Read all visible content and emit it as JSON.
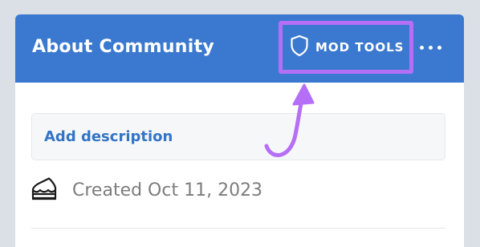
{
  "widget": {
    "title": "About Community",
    "mod_tools_label": "MOD TOOLS",
    "description_link": "Add description",
    "created": "Created Oct 11, 2023"
  },
  "icons": {
    "mod_tools": "shield-icon",
    "more": "more-horizontal-icon",
    "created": "cake-icon"
  },
  "colors": {
    "header": "#3a79cf",
    "link": "#3274c6",
    "highlight": "#b56ff7",
    "background": "#dae0e6"
  }
}
